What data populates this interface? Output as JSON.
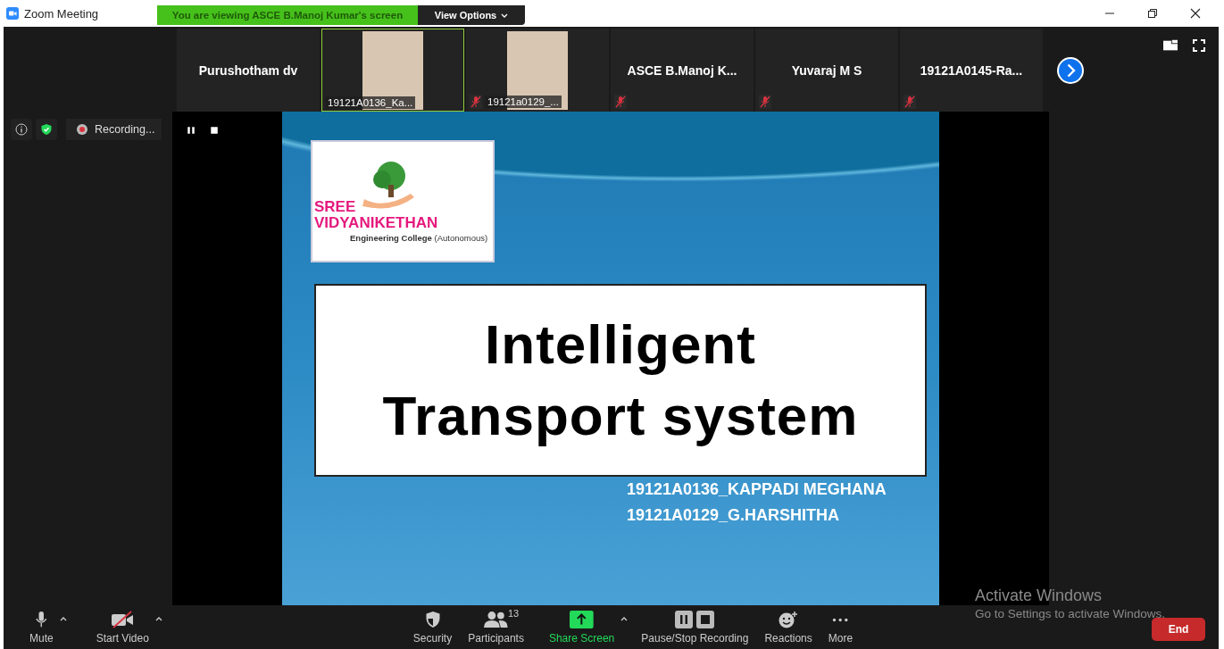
{
  "window": {
    "title": "Zoom Meeting"
  },
  "share_banner": {
    "text": "You are viewing ASCE B.Manoj Kumar's screen",
    "view_options": "View Options"
  },
  "participants": [
    {
      "kind": "name",
      "name": "Purushotham dv",
      "muted": false,
      "selected": false
    },
    {
      "kind": "video",
      "name": "19121A0136_Ka...",
      "muted": false,
      "selected": true
    },
    {
      "kind": "video",
      "name": "19121a0129_...",
      "muted": true,
      "selected": false
    },
    {
      "kind": "name",
      "name": "ASCE  B.Manoj  K...",
      "muted": true,
      "selected": false
    },
    {
      "kind": "name",
      "name": "Yuvaraj M S",
      "muted": true,
      "selected": false
    },
    {
      "kind": "name",
      "name": "19121A0145-Ra...",
      "muted": true,
      "selected": false
    }
  ],
  "recording": {
    "label": "Recording..."
  },
  "slide": {
    "logo_line_1": "SREE",
    "logo_line_2": "VIDYANIKETHAN",
    "logo_subtitle": "**Engineering College** (Autonomous)",
    "title_lines": [
      "Intelligent",
      "Transport system"
    ],
    "authors": [
      "19121A0136_KAPPADI MEGHANA",
      "19121A0129_G.HARSHITHA"
    ]
  },
  "toolbar": [
    {
      "kind": "mic",
      "label": "Mute",
      "caret": true
    },
    {
      "kind": "video-off",
      "label": "Start Video",
      "caret": true
    },
    {
      "kind": "security",
      "label": "Security",
      "caret": false
    },
    {
      "kind": "participants",
      "label": "Participants",
      "count": "13",
      "caret": false
    },
    {
      "kind": "share",
      "label": "Share Screen",
      "caret": true
    },
    {
      "kind": "recording",
      "label": "Pause/Stop Recording",
      "caret": false
    },
    {
      "kind": "reactions",
      "label": "Reactions",
      "caret": false
    },
    {
      "kind": "more",
      "label": "More",
      "caret": false
    }
  ],
  "end_button": "End",
  "windows_notice": {
    "title": "Activate Windows",
    "subtitle": "Go to Settings to activate Windows."
  }
}
